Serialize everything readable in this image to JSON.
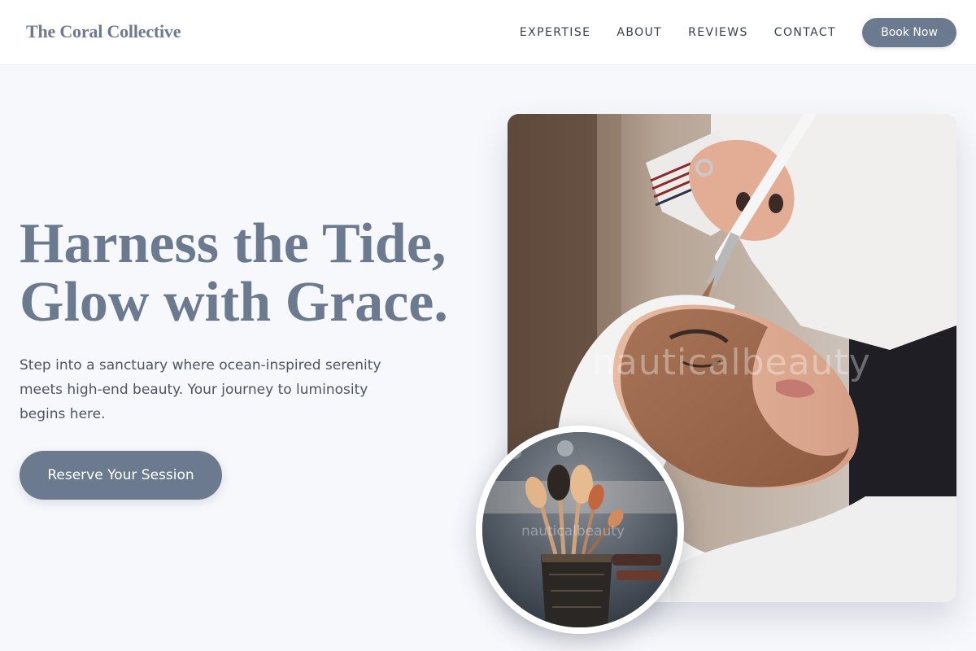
{
  "brand": {
    "name": "The Coral Collective"
  },
  "nav": {
    "items": [
      {
        "label": "EXPERTISE"
      },
      {
        "label": "ABOUT"
      },
      {
        "label": "REVIEWS"
      },
      {
        "label": "CONTACT"
      }
    ],
    "cta_label": "Book Now"
  },
  "hero": {
    "title_line1": "Harness the Tide,",
    "title_line2": "Glow with Grace.",
    "subtitle": "Step into a sanctuary where ocean-inspired serenity meets high-end beauty. Your journey to luminosity begins here.",
    "cta_label": "Reserve Your Session"
  },
  "images": {
    "main_watermark": "nauticalbeauty",
    "circle_watermark": "nauticalbeauty",
    "main_subject": "facial-treatment-photo",
    "circle_subject": "makeup-brushes-photo"
  },
  "colors": {
    "accent": "#6b7a8f",
    "background": "#f7f8fc",
    "header_bg": "#ffffff",
    "text": "#374151"
  }
}
